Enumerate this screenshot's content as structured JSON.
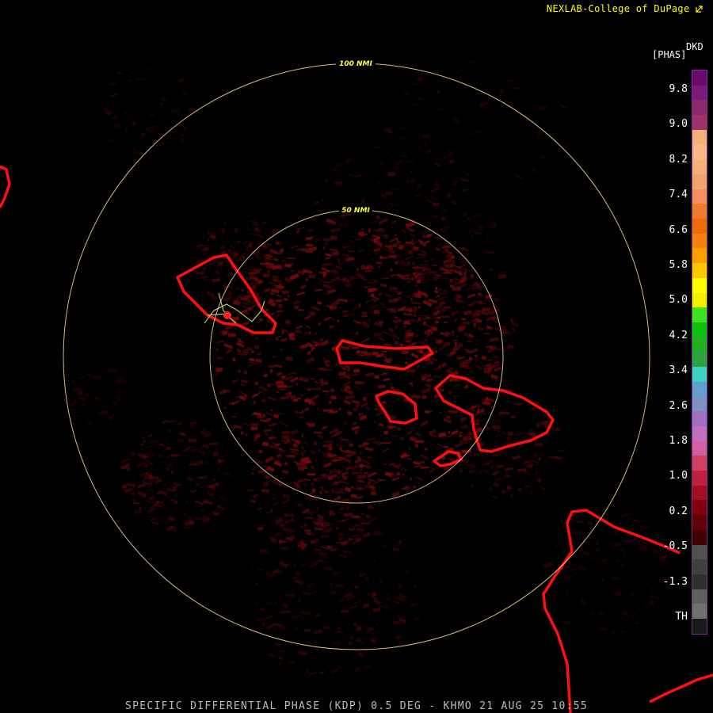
{
  "credit": "NEXLAB-College of DuPage",
  "footer": "SPECIFIC DIFFERENTIAL PHASE (KDP) 0.5 DEG - KHMO 21 AUG 25 10:55",
  "legend": {
    "station": "DKD",
    "units": "[PHAS]",
    "ticks": [
      "9.8",
      "9.0",
      "8.2",
      "7.4",
      "6.6",
      "5.8",
      "5.0",
      "4.2",
      "3.4",
      "2.6",
      "1.8",
      "1.0",
      "0.2",
      "-0.5",
      "-1.3",
      "TH"
    ],
    "colors": [
      "#6a0a6a",
      "#7a1a7a",
      "#8a2a6a",
      "#a0306a",
      "#f4b07a",
      "#f6b888",
      "#f4b07a",
      "#f2a470",
      "#f29060",
      "#f07a30",
      "#f06a10",
      "#f48010",
      "#f8a000",
      "#fcc800",
      "#ffff00",
      "#f0f000",
      "#40e020",
      "#10c010",
      "#20b020",
      "#30a040",
      "#40d0c0",
      "#60a0d0",
      "#8090c0",
      "#a070c0",
      "#c070c0",
      "#d060a0",
      "#d04060",
      "#c02040",
      "#a01020",
      "#800010",
      "#600008",
      "#400000",
      "#505050",
      "#404040",
      "#303030",
      "#606060",
      "#707070",
      "#1a1a1a"
    ]
  },
  "range_rings": [
    "100 NMI",
    "50 NMI"
  ],
  "colors": {
    "ring": "#ffd8a0",
    "outline": "#ff1010",
    "echo": "#7a0a0a"
  }
}
